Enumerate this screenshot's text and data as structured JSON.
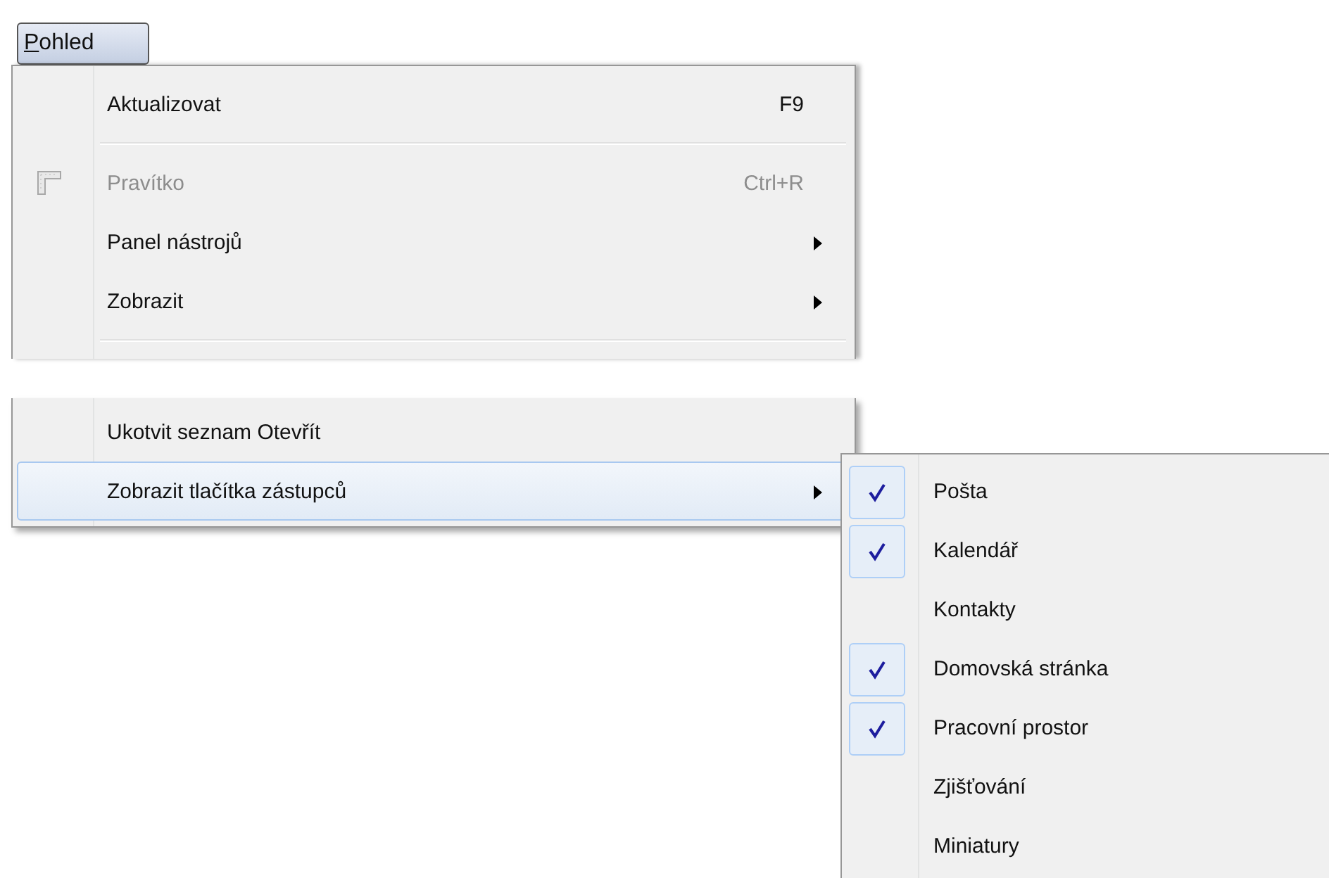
{
  "menu_bar": {
    "title": "Pohled",
    "selected": true
  },
  "menu": {
    "upper_groups": [
      [
        {
          "label": "Aktualizovat",
          "shortcut": "F9",
          "kind": "item",
          "disabled": false,
          "has_submenu": false,
          "selected": false
        }
      ],
      [
        {
          "label": "Pravítko",
          "shortcut": "Ctrl+R",
          "kind": "icon_item",
          "disabled": true,
          "has_submenu": false,
          "selected": false
        },
        {
          "label": "Panel nástrojů",
          "kind": "item",
          "disabled": false,
          "has_submenu": true,
          "selected": false
        },
        {
          "label": "Zobrazit",
          "kind": "item",
          "disabled": false,
          "has_submenu": true,
          "selected": false
        }
      ]
    ],
    "lower_items": [
      {
        "label": "Ukotvit seznam Otevřít",
        "kind": "item",
        "disabled": false,
        "has_submenu": false,
        "selected": false
      },
      {
        "label": "Zobrazit tlačítka zástupců",
        "kind": "item",
        "disabled": false,
        "has_submenu": true,
        "selected": true
      }
    ]
  },
  "submenu": {
    "items": [
      {
        "label": "Pošta",
        "checked": true
      },
      {
        "label": "Kalendář",
        "checked": true
      },
      {
        "label": "Kontakty",
        "checked": false
      },
      {
        "label": "Domovská stránka",
        "checked": true
      },
      {
        "label": "Pracovní prostor",
        "checked": true
      },
      {
        "label": "Zjišťování",
        "checked": false
      },
      {
        "label": "Miniatury",
        "checked": false
      }
    ]
  }
}
